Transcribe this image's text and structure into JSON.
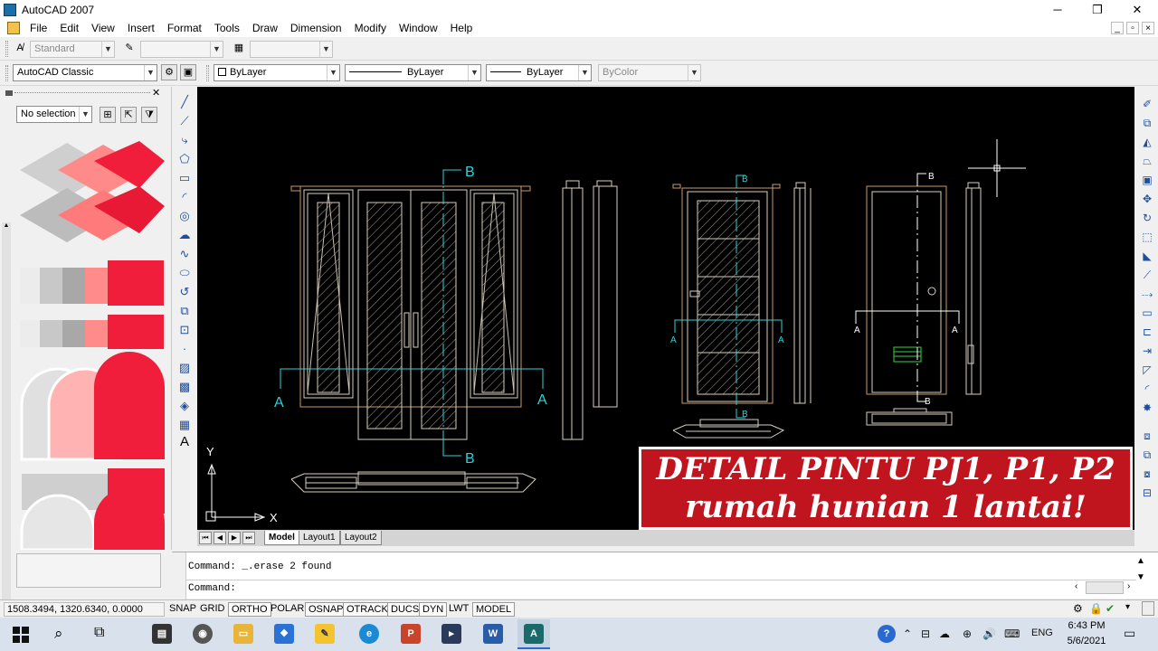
{
  "window": {
    "title": "AutoCAD 2007",
    "minimize": "─",
    "maximize": "❐",
    "close": "✕"
  },
  "menu": [
    "File",
    "Edit",
    "View",
    "Insert",
    "Format",
    "Tools",
    "Draw",
    "Dimension",
    "Modify",
    "Window",
    "Help"
  ],
  "toolbar": {
    "text_style": "Standard",
    "workspace": "AutoCAD Classic",
    "layer_color": "ByLayer",
    "linetype": "ByLayer",
    "lineweight": "ByLayer",
    "plot_style": "ByColor"
  },
  "properties": {
    "selection": "No selection"
  },
  "drawing": {
    "section_a": "A",
    "section_b": "B",
    "axis_x": "X",
    "axis_y": "Y"
  },
  "banner": {
    "line1": "DETAIL PINTU PJ1, P1, P2",
    "line2": "rumah hunian 1 lantai!"
  },
  "tabs": [
    "Model",
    "Layout1",
    "Layout2"
  ],
  "command": {
    "history": "Command:  _.erase 2 found",
    "prompt": "Command:"
  },
  "status": {
    "coords": "1508.3494, 1320.6340, 0.0000",
    "toggles": [
      "SNAP",
      "GRID",
      "ORTHO",
      "POLAR",
      "OSNAP",
      "OTRACK",
      "DUCS",
      "DYN",
      "LWT",
      "MODEL"
    ]
  },
  "taskbar": {
    "lang": "ENG",
    "time": "6:43 PM",
    "date": "5/6/2021"
  },
  "colors": {
    "canvas": "#000000",
    "banner": "#c0141e",
    "cyan": "#2fd0d8",
    "door": "#d8cfc0",
    "frame": "#c89a6a"
  }
}
